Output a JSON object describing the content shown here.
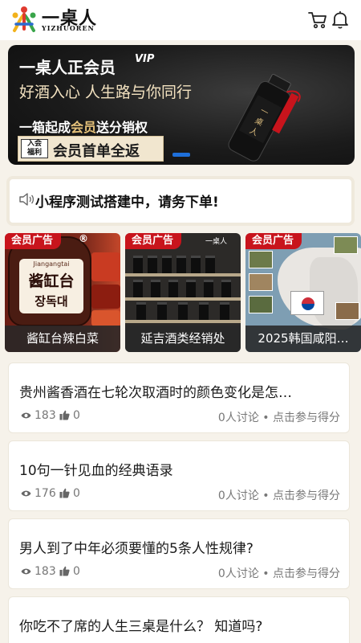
{
  "header": {
    "logo_cn": "一桌人",
    "logo_en": "YIZHUOREN",
    "icons": [
      "cart-icon",
      "bell-icon"
    ]
  },
  "banner": {
    "title": "一桌人正会员",
    "vip": "VIP",
    "subtitle": "好酒入心 人生路与你同行",
    "line3_prefix": "一箱起成",
    "line3_highlight": "会员",
    "line3_suffix": "送分销权",
    "badge_tag_line1": "入会",
    "badge_tag_line2": "福利",
    "badge_text": "会员首单全返",
    "bottle_label": "一桌人"
  },
  "notice": {
    "text": "小程序测试搭建中，请务下单!"
  },
  "ads": [
    {
      "tag": "会员广告",
      "caption": "酱缸台辣白菜",
      "jar_en": "Jiangangtai",
      "jar_cn": "酱缸台",
      "jar_kr": "장독대",
      "registered": "®"
    },
    {
      "tag": "会员广告",
      "caption": "延吉酒类经销处",
      "sign": "一桌人"
    },
    {
      "tag": "会员广告",
      "caption": "2025韩国咸阳…"
    }
  ],
  "posts": [
    {
      "title": "贵州酱香酒在七轮次取酒时的颜色变化是怎…",
      "views": "183",
      "likes": "0",
      "discuss": "0人讨论 • 点击参与得分"
    },
    {
      "title": "10句一针见血的经典语录",
      "views": "176",
      "likes": "0",
      "discuss": "0人讨论 • 点击参与得分"
    },
    {
      "title": "男人到了中年必须要懂的5条人性规律?",
      "views": "183",
      "likes": "0",
      "discuss": "0人讨论 • 点击参与得分"
    },
    {
      "title": "你吃不了席的人生三桌是什么？ 知道吗?",
      "views": "",
      "likes": "",
      "discuss": ""
    }
  ],
  "colors": {
    "accent_red": "#c8141c",
    "page_bg": "#f6f2ea",
    "banner_gold": "#e6c27a",
    "indicator_blue": "#1e6fd9"
  }
}
